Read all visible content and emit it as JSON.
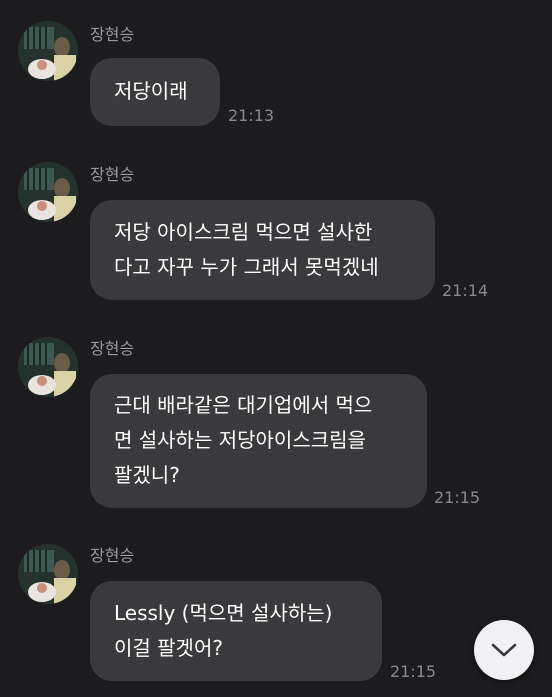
{
  "messages": [
    {
      "sender": "장현승",
      "lines": [
        "저당이래"
      ],
      "time": "21:13"
    },
    {
      "sender": "장현승",
      "lines": [
        "저당 아이스크림 먹으면 설사한",
        "다고 자꾸 누가 그래서 못먹겠네"
      ],
      "time": "21:14"
    },
    {
      "sender": "장현승",
      "lines": [
        "근대 배라같은 대기업에서 먹으",
        "면 설사하는 저당아이스크림을",
        "팔겠니?"
      ],
      "time": "21:15"
    },
    {
      "sender": "장현승",
      "lines": [
        "Lessly (먹으면 설사하는)",
        "이걸 팔겟어?"
      ],
      "time": "21:15"
    }
  ],
  "scroll_button": {
    "icon": "chevron-down-icon"
  }
}
